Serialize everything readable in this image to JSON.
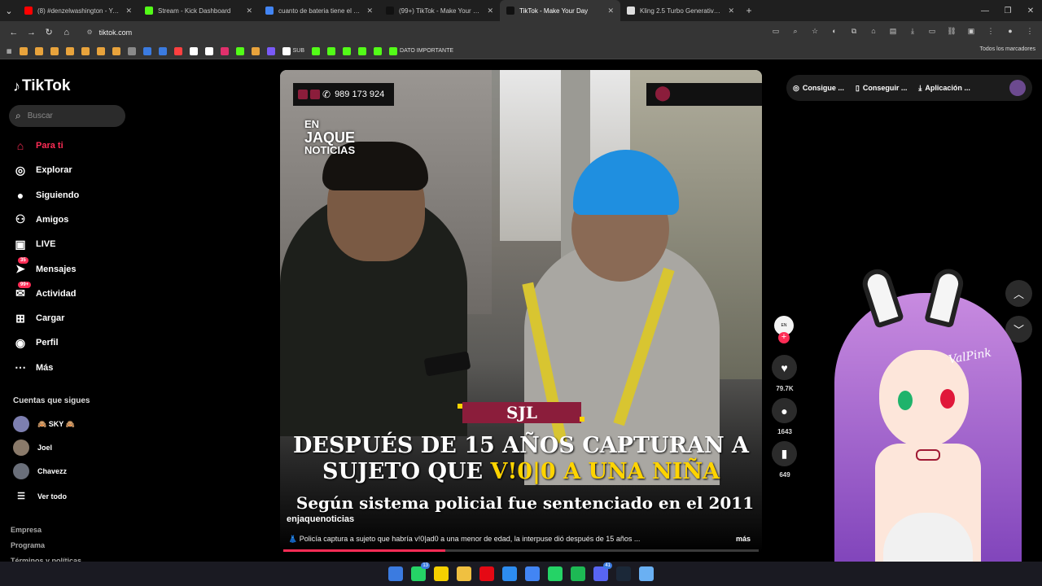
{
  "browser": {
    "tabs": [
      {
        "title": "(8) #denzelwashington - YouTube",
        "color": "#ff0000",
        "active": false
      },
      {
        "title": "Stream - Kick Dashboard",
        "color": "#53fc18",
        "active": false
      },
      {
        "title": "cuanto de bateria tiene el samsung",
        "color": "#4285f4",
        "active": false
      },
      {
        "title": "(99+) TikTok - Make Your Day",
        "color": "#111111",
        "active": false
      },
      {
        "title": "TikTok - Make Your Day",
        "color": "#111111",
        "active": true
      },
      {
        "title": "Kling 2.5 Turbo Generative AI Model",
        "color": "#dddddd",
        "active": false
      }
    ],
    "url": "tiktok.com",
    "bookmarks": [
      {
        "label": "",
        "color": "#e8a33c"
      },
      {
        "label": "",
        "color": "#e8a33c"
      },
      {
        "label": "",
        "color": "#e8a33c"
      },
      {
        "label": "",
        "color": "#e8a33c"
      },
      {
        "label": "",
        "color": "#e8a33c"
      },
      {
        "label": "",
        "color": "#e8a33c"
      },
      {
        "label": "",
        "color": "#e8a33c"
      },
      {
        "label": "",
        "color": "#8a8a8a"
      },
      {
        "label": "",
        "color": "#3b7be0"
      },
      {
        "label": "",
        "color": "#3b7be0"
      },
      {
        "label": "",
        "color": "#ff4040"
      },
      {
        "label": "",
        "color": "#ffffff"
      },
      {
        "label": "",
        "color": "#ffffff"
      },
      {
        "label": "",
        "color": "#e1306c"
      },
      {
        "label": "",
        "color": "#53fc18"
      },
      {
        "label": "",
        "color": "#e8a33c"
      },
      {
        "label": "",
        "color": "#7a5af8"
      },
      {
        "label": "SUB",
        "color": "#ffffff"
      },
      {
        "label": "",
        "color": "#53fc18"
      },
      {
        "label": "",
        "color": "#53fc18"
      },
      {
        "label": "",
        "color": "#53fc18"
      },
      {
        "label": "",
        "color": "#53fc18"
      },
      {
        "label": "",
        "color": "#53fc18"
      },
      {
        "label": "DATO IMPORTANTE",
        "color": "#53fc18"
      }
    ],
    "bookmarks_all": "Todos los marcadores"
  },
  "sidebar": {
    "logo": "TikTok",
    "search_placeholder": "Buscar",
    "nav": [
      {
        "label": "Para ti",
        "icon": "home-icon",
        "active": true,
        "badge": ""
      },
      {
        "label": "Explorar",
        "icon": "compass-icon",
        "active": false,
        "badge": ""
      },
      {
        "label": "Siguiendo",
        "icon": "following-icon",
        "active": false,
        "badge": ""
      },
      {
        "label": "Amigos",
        "icon": "friends-icon",
        "active": false,
        "badge": ""
      },
      {
        "label": "LIVE",
        "icon": "live-icon",
        "active": false,
        "badge": ""
      },
      {
        "label": "Mensajes",
        "icon": "messages-icon",
        "active": false,
        "badge": "35"
      },
      {
        "label": "Actividad",
        "icon": "activity-icon",
        "active": false,
        "badge": "99+"
      },
      {
        "label": "Cargar",
        "icon": "upload-icon",
        "active": false,
        "badge": ""
      },
      {
        "label": "Perfil",
        "icon": "profile-icon",
        "active": false,
        "badge": ""
      },
      {
        "label": "Más",
        "icon": "more-icon",
        "active": false,
        "badge": ""
      }
    ],
    "following_title": "Cuentas que sigues",
    "following": [
      {
        "name": "🙈 SKY 🙈"
      },
      {
        "name": "Joel"
      },
      {
        "name": "Chavezz"
      }
    ],
    "see_all": "Ver todo",
    "footer": [
      "Empresa",
      "Programa",
      "Términos y políticas"
    ]
  },
  "topright": {
    "items": [
      "Consigue ...",
      "Conseguir ...",
      "Aplicación ..."
    ]
  },
  "video": {
    "phone": "989 173 924",
    "brand_line1": "EN",
    "brand_line2": "JAQUE",
    "brand_line3": "NOTICIAS",
    "tag": "SJL",
    "headline_part1": "DESPUÉS DE 15 AÑOS CAPTURAN A",
    "headline_part2": "SUJETO QUE ",
    "headline_highlight": "V!0|0  A UNA NIÑA",
    "subtitle": "Según sistema policial fue sentenciado en el 2011",
    "author": "enjaquenoticias",
    "description": "👗 Policía captura a sujeto que habría v!0|ad0 a una menor de edad, la interpuse dió después de 15 años ...",
    "more": "más",
    "progress": 0.34
  },
  "actions": {
    "likes": "79.7K",
    "comments": "1643",
    "saves": "649"
  },
  "overlay": {
    "signature": "ValPink"
  },
  "taskbar": {
    "icons": [
      {
        "name": "windows-start-icon",
        "color": "#3b7be0",
        "badge": ""
      },
      {
        "name": "whatsapp-icon",
        "color": "#25d366",
        "badge": "13"
      },
      {
        "name": "sticky-notes-icon",
        "color": "#f5d000",
        "badge": ""
      },
      {
        "name": "file-explorer-icon",
        "color": "#f0c040",
        "badge": ""
      },
      {
        "name": "netflix-icon",
        "color": "#e50914",
        "badge": ""
      },
      {
        "name": "photos-icon",
        "color": "#2d8cf0",
        "badge": ""
      },
      {
        "name": "chrome-icon",
        "color": "#4285f4",
        "badge": ""
      },
      {
        "name": "whatsapp-alt-icon",
        "color": "#25d366",
        "badge": ""
      },
      {
        "name": "spotify-icon",
        "color": "#1db954",
        "badge": ""
      },
      {
        "name": "discord-icon",
        "color": "#5865f2",
        "badge": "41"
      },
      {
        "name": "steam-icon",
        "color": "#1b2838",
        "badge": ""
      },
      {
        "name": "notepad-icon",
        "color": "#6ab0f3",
        "badge": ""
      }
    ]
  }
}
